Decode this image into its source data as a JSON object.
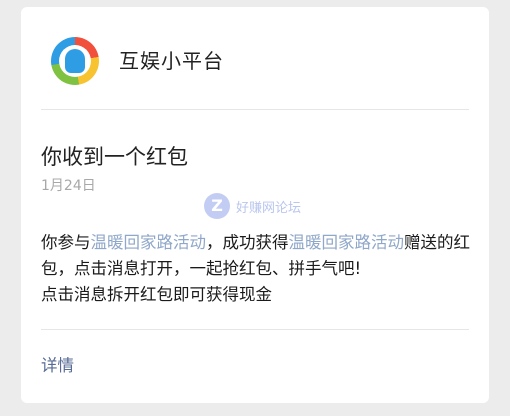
{
  "header": {
    "app_name": "互娱小平台"
  },
  "message": {
    "title": "你收到一个红包",
    "date": "1月24日",
    "body_part1": "你参与",
    "event_name": "温暖回家路活动",
    "body_part2": "，成功获得",
    "event_name_2": "温暖回家路活动",
    "body_part3": "赠送的红包，点击消息打开，一起抢红包、拼手气吧!",
    "body_line3": "点击消息拆开红包即可获得现金"
  },
  "footer": {
    "details_label": "详情"
  },
  "watermark": {
    "glyph": "Z",
    "text": "好赚网论坛"
  },
  "colors": {
    "link": "#576b95",
    "highlight": "#8fa7c9",
    "background": "#ececec"
  }
}
